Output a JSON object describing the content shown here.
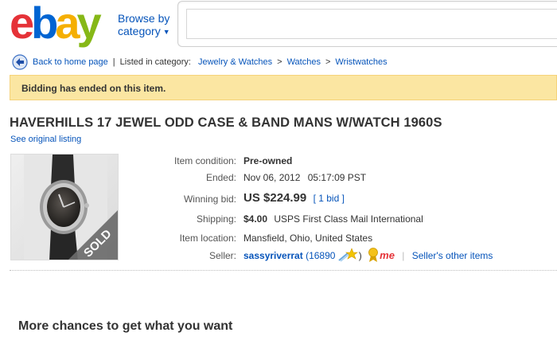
{
  "header": {
    "logo": {
      "e": "e",
      "b": "b",
      "a": "a",
      "y": "y"
    },
    "colors": {
      "e": "#e53238",
      "b": "#0064d2",
      "a": "#f5af02",
      "y": "#86b817"
    },
    "browse_line1": "Browse by",
    "browse_line2": "category",
    "search_value": ""
  },
  "breadcrumb": {
    "back_label": "Back to home page",
    "listed_label": "Listed in category:",
    "items": [
      "Jewelry & Watches",
      "Watches",
      "Wristwatches"
    ]
  },
  "alert": {
    "text": "Bidding has ended on this item."
  },
  "item": {
    "title": "HAVERHILLS 17 JEWEL ODD CASE & BAND MANS W/WATCH 1960S",
    "see_original": "See original listing",
    "sold_badge": "SOLD",
    "condition_label": "Item condition:",
    "condition_value": "Pre-owned",
    "ended_label": "Ended:",
    "ended_value": "Nov 06, 2012",
    "ended_time": "05:17:09 PST",
    "winning_label": "Winning bid:",
    "winning_value": "US $224.99",
    "bid_count": "[ 1 bid ]",
    "shipping_label": "Shipping:",
    "shipping_cost": "$4.00",
    "shipping_method": "USPS First Class Mail International",
    "location_label": "Item location:",
    "location_value": "Mansfield, Ohio, United States",
    "seller_label": "Seller:",
    "seller_name": "sassyriverrat",
    "seller_score": "(16890",
    "seller_close": ")",
    "me_badge": "me",
    "other_items": "Seller's other items"
  },
  "more_chances": "More chances to get what you want"
}
